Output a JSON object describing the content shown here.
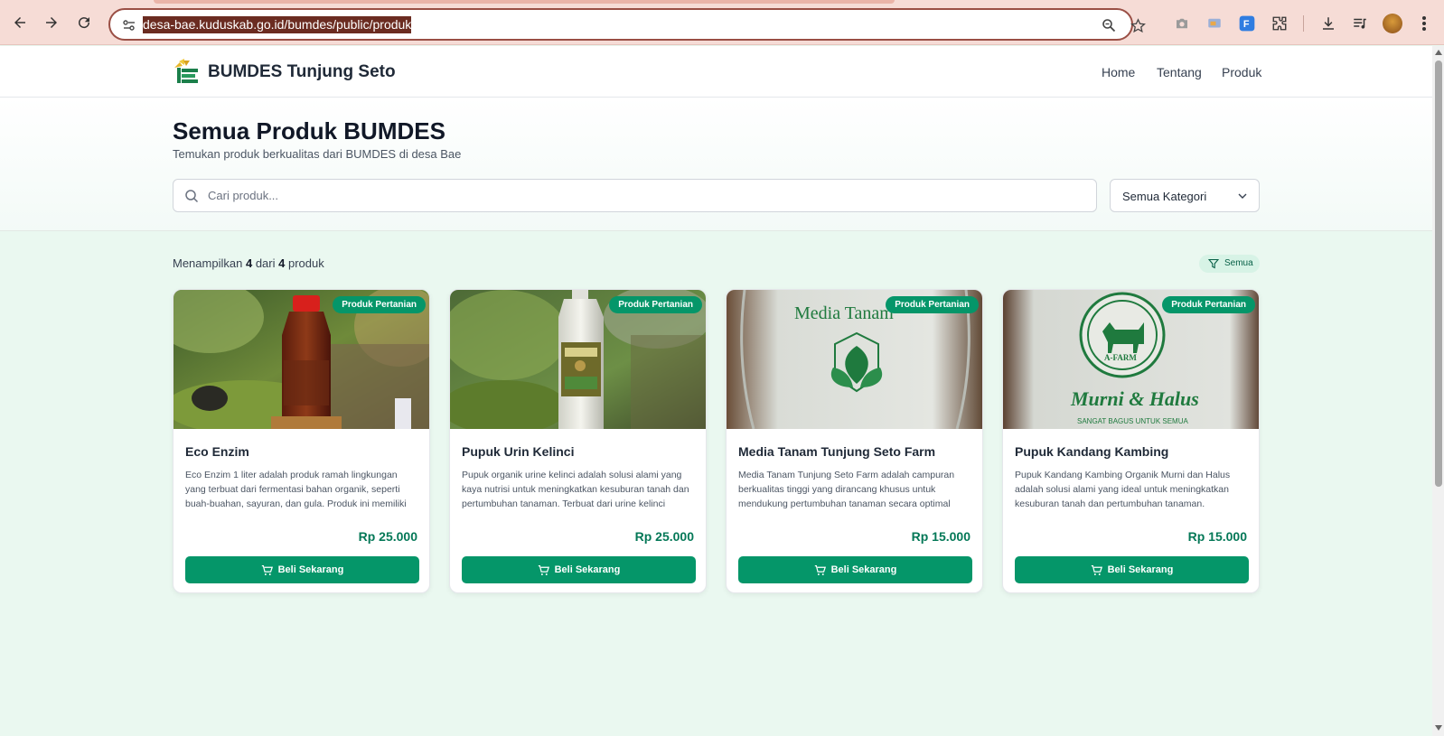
{
  "browser": {
    "url": "desa-bae.kuduskab.go.id/bumdes/public/produk",
    "icons": [
      "back-icon",
      "forward-icon",
      "reload-icon",
      "site-settings-icon",
      "zoom-icon",
      "bookmark-star-icon",
      "camera-icon",
      "cast-icon",
      "extension-f-icon",
      "extensions-puzzle-icon",
      "download-icon",
      "media-control-icon",
      "profile-avatar",
      "menu-icon"
    ]
  },
  "header": {
    "brand": "BUMDES Tunjung Seto",
    "nav": [
      {
        "label": "Home"
      },
      {
        "label": "Tentang"
      },
      {
        "label": "Produk"
      }
    ]
  },
  "hero": {
    "title": "Semua Produk BUMDES",
    "subtitle": "Temukan produk berkualitas dari BUMDES di desa Bae",
    "search_placeholder": "Cari produk...",
    "category_selected": "Semua Kategori"
  },
  "results": {
    "prefix": "Menampilkan",
    "shown": "4",
    "middle": "dari",
    "total": "4",
    "suffix": "produk",
    "filter_label": "Semua"
  },
  "products": [
    {
      "badge": "Produk Pertanian",
      "title": "Eco Enzim",
      "description": "Eco Enzim 1 liter adalah produk ramah lingkungan yang terbuat dari fermentasi bahan organik, seperti buah-buahan, sayuran, dan gula. Produk ini memiliki",
      "price": "Rp 25.000",
      "button": "Beli Sekarang"
    },
    {
      "badge": "Produk Pertanian",
      "title": "Pupuk Urin Kelinci",
      "description": "Pupuk organik urine kelinci adalah solusi alami yang kaya nutrisi untuk meningkatkan kesuburan tanah dan pertumbuhan tanaman. Terbuat dari urine kelinci",
      "price": "Rp 25.000",
      "button": "Beli Sekarang"
    },
    {
      "badge": "Produk Pertanian",
      "title": "Media Tanam Tunjung Seto Farm",
      "description": "Media Tanam Tunjung Seto Farm adalah campuran berkualitas tinggi yang dirancang khusus untuk mendukung pertumbuhan tanaman secara optimal",
      "price": "Rp 15.000",
      "button": "Beli Sekarang",
      "image_text": "Media Tanam"
    },
    {
      "badge": "Produk Pertanian",
      "title": "Pupuk Kandang Kambing",
      "description": "Pupuk Kandang Kambing Organik Murni dan Halus adalah solusi alami yang ideal untuk meningkatkan kesuburan tanah dan pertumbuhan tanaman.",
      "price": "Rp 15.000",
      "button": "Beli Sekarang",
      "image_text": "Murni & Halus",
      "image_subtext": "SANGAT BAGUS UNTUK SEMUA",
      "image_brand": "A-FARM"
    }
  ],
  "colors": {
    "primary": "#059669",
    "price": "#047857",
    "chrome": "#f6dcd6"
  }
}
